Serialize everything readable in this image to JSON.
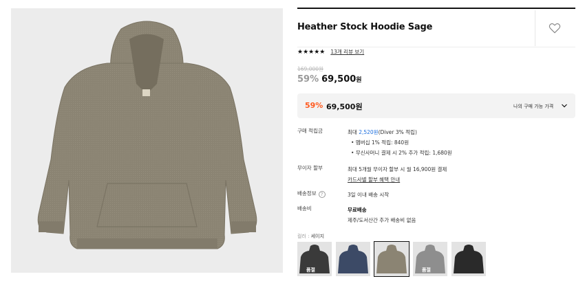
{
  "product": {
    "name": "Heather Stock Hoodie Sage",
    "image_color": "#8b8473"
  },
  "rating": {
    "stars": "★★★★★",
    "review_link": "13개 리뷰 보기"
  },
  "pricing": {
    "original": "169,000원",
    "discount": "59%",
    "price": "69,500",
    "currency": "원"
  },
  "best_price": {
    "discount": "59%",
    "price": "69,500원",
    "label": "나의 구매 가능 가격"
  },
  "points": {
    "label": "구매 적립금",
    "max_prefix": "최대 ",
    "max_amount": "2,520원",
    "max_suffix": "(Diver 3% 적립)",
    "bullets": [
      "멤버십 1% 적립: 840원",
      "무신사머니 결제 시 2% 추가 적립: 1,680원"
    ]
  },
  "installment": {
    "label": "무이자 할부",
    "text": "최대 5개월 무이자 할부 시 월 16,900원 결제",
    "link": "카드사별 할부 혜택 안내"
  },
  "shipping_info": {
    "label": "배송정보",
    "help": "?",
    "text": "3일 이내 배송 시작"
  },
  "shipping_fee": {
    "label": "배송비",
    "title": "무료배송",
    "text": "제주/도서산간 추가 배송비 없음"
  },
  "color_option": {
    "label": "컬러 : ",
    "value": "세이지"
  },
  "swatches": [
    {
      "color": "#3a3a3a",
      "badge": "품절"
    },
    {
      "color": "#3c4a66",
      "badge": ""
    },
    {
      "color": "#8b8473",
      "badge": ""
    },
    {
      "color": "#8e8e8e",
      "badge": "품절"
    },
    {
      "color": "#2a2a2a",
      "badge": ""
    }
  ],
  "colors": {
    "accent": "#ff5a1f",
    "link_blue": "#1a6dde"
  }
}
